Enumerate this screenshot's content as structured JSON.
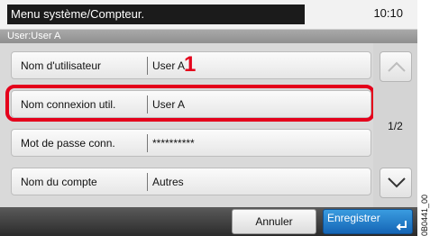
{
  "header": {
    "title": "Menu système/Compteur.",
    "clock": "10:10",
    "user_line": "User:User A"
  },
  "rows": [
    {
      "label": "Nom d'utilisateur",
      "value": "User A"
    },
    {
      "label": "Nom connexion util.",
      "value": "User A"
    },
    {
      "label": "Mot de passe conn.",
      "value": "**********"
    },
    {
      "label": "Nom du compte",
      "value": "Autres"
    }
  ],
  "pager": {
    "indicator": "1/2",
    "up_icon": "chevron-up-icon",
    "down_icon": "chevron-down-icon"
  },
  "footer": {
    "cancel_label": "Annuler",
    "save_label": "Enregistrer",
    "save_icon": "enter-return-icon"
  },
  "annotation": {
    "callout_number": "1",
    "highlight_color": "#e4001b"
  },
  "side_code": "0B0441_00",
  "colors": {
    "title_bg": "#1b1b1b",
    "save_accent": "#1e78c8",
    "footer_bg": "#3c3c3c"
  }
}
